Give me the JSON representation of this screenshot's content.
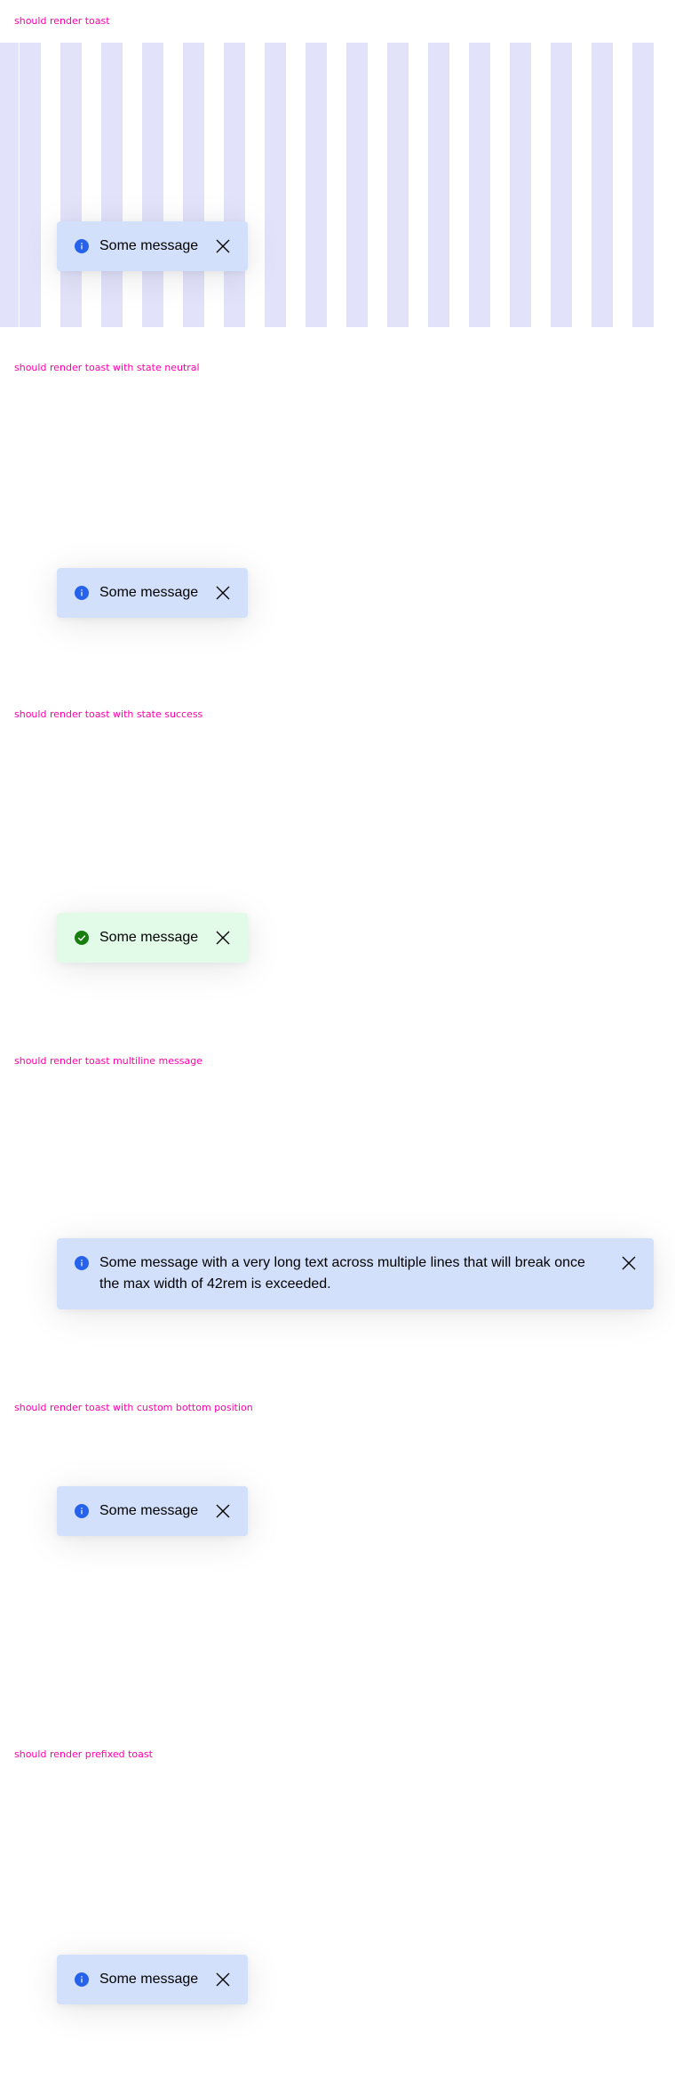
{
  "sections": [
    {
      "label": "should render toast",
      "state": "neutral",
      "message": "Some message",
      "background": "stripes"
    },
    {
      "label": "should render toast with state neutral",
      "state": "neutral",
      "message": "Some message"
    },
    {
      "label": "should render toast with state success",
      "state": "success",
      "message": "Some message"
    },
    {
      "label": "should render toast multiline message",
      "state": "neutral",
      "message": "Some message with a very long text across multiple lines that will break once the max width of 42rem is exceeded."
    },
    {
      "label": "should render toast with custom bottom position",
      "state": "neutral",
      "message": "Some message"
    },
    {
      "label": "should render prefixed toast",
      "state": "neutral",
      "message": "Some message"
    }
  ],
  "icons": {
    "neutral": "info-icon",
    "success": "success-icon",
    "close": "close-icon"
  },
  "colors": {
    "label": "#ff00aa",
    "toast_neutral_bg": "#d3e0fc",
    "toast_success_bg": "#e2fbe9",
    "info_icon": "#2762ec",
    "success_icon": "#197e10",
    "stripe": "#e2e2fb"
  }
}
